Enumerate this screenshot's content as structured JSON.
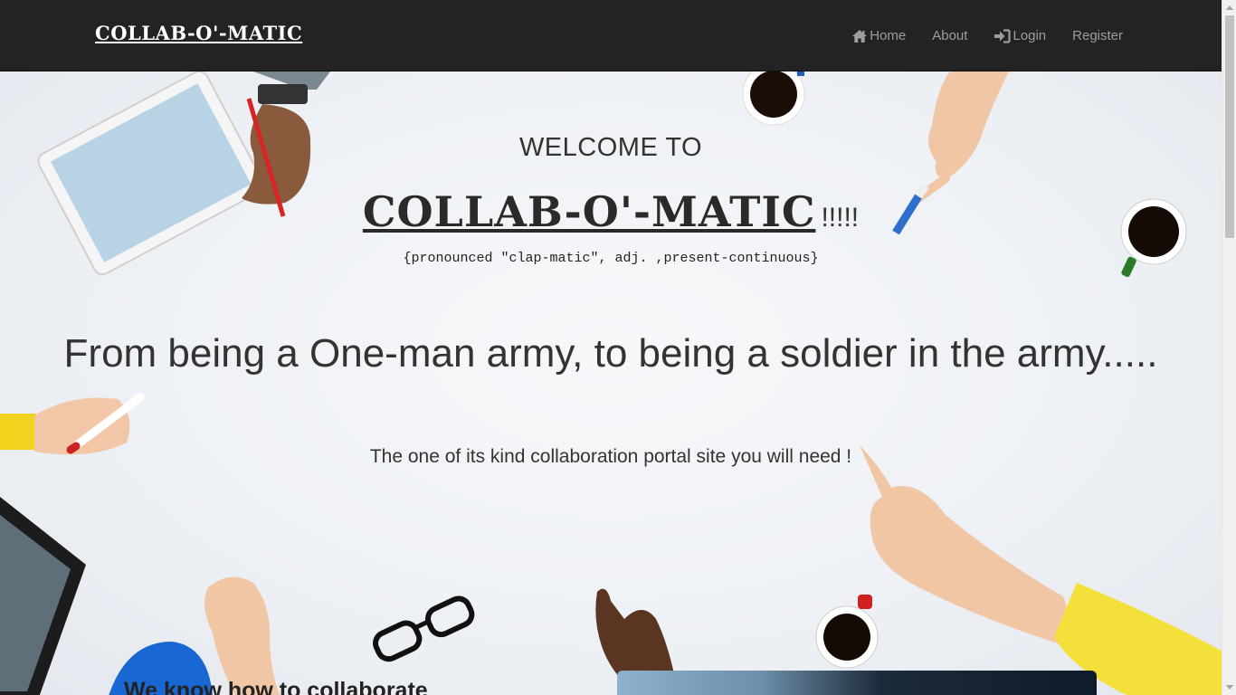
{
  "navbar": {
    "brand": "COLLAB-O'-MATIC",
    "items": [
      {
        "label": "Home",
        "icon": "home-icon"
      },
      {
        "label": "About",
        "icon": ""
      },
      {
        "label": "Login",
        "icon": "login-icon"
      },
      {
        "label": "Register",
        "icon": ""
      }
    ]
  },
  "hero": {
    "welcome": "WELCOME TO",
    "title": "COLLAB-O'-MATIC",
    "title_suffix": "!!!!!",
    "pronunciation": "{pronounced \"clap-matic\", adj. ,present-continuous}",
    "tagline": "From being a One-man army, to being a soldier in the army.....",
    "subline": "The one of its kind collaboration portal site you will need !",
    "section_heading": "We know how to collaborate"
  },
  "colors": {
    "navbar_bg": "#232323",
    "nav_text": "#9d9d9d",
    "hero_bg": "#eef1f5",
    "text": "#333333"
  }
}
